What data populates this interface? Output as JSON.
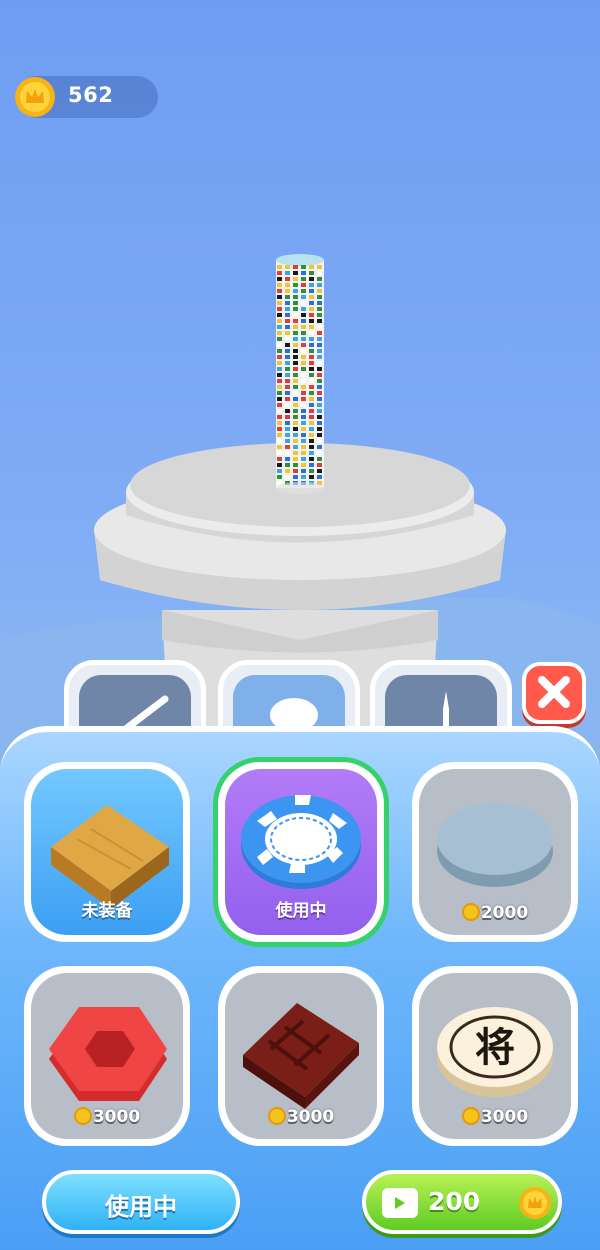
{
  "hud": {
    "coins": "562",
    "coin_icon": "crown-coin-icon"
  },
  "tabs": [
    {
      "name": "stick",
      "icon": "stick-icon",
      "active": false
    },
    {
      "name": "disc",
      "icon": "disc-icon",
      "active": true
    },
    {
      "name": "knife",
      "icon": "knife-icon",
      "active": false
    }
  ],
  "close_icon": "close-icon",
  "items": [
    {
      "name": "wood-block",
      "label": "未装备",
      "state": "owned"
    },
    {
      "name": "poker-chip",
      "label": "使用中",
      "state": "in_use"
    },
    {
      "name": "grey-disc",
      "price": "2000",
      "state": "locked"
    },
    {
      "name": "red-hexagon",
      "price": "3000",
      "state": "locked"
    },
    {
      "name": "chocolate-bar",
      "price": "3000",
      "state": "locked"
    },
    {
      "name": "chess-piece",
      "price": "3000",
      "state": "locked",
      "glyph": "将"
    }
  ],
  "buttons": {
    "use_label": "使用中",
    "video_price": "200"
  },
  "colors": {
    "background": "#7aa8f4",
    "selected_border": "#35d16c",
    "in_use_card": "#9a66f0",
    "owned_card": "#4aa8f5",
    "locked_card": "#b8bec8",
    "close_button": "#ff5a4c",
    "video_button": "#6fd12a"
  }
}
